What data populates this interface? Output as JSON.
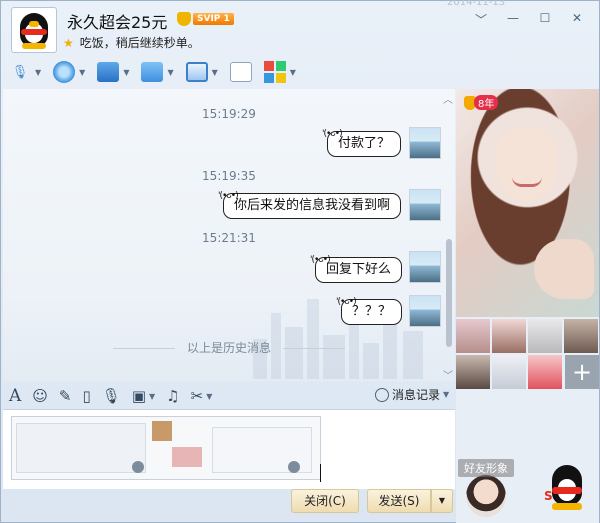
{
  "header": {
    "nickname": "永久超会25元",
    "vip_label": "SVIP 1",
    "signature": "吃饭，稍后继续秒单。",
    "faint_date": "2014-11-13",
    "controls": [
      "﹀",
      "—",
      "☐",
      "✕"
    ]
  },
  "toolbar": {
    "icons": [
      "microphone-icon",
      "camera-icon",
      "screen-share-icon",
      "send-file-icon",
      "remote-desktop-icon",
      "note-icon",
      "apps-icon"
    ]
  },
  "chat": {
    "messages": [
      {
        "time": "15:19:29",
        "text": "付款了？"
      },
      {
        "time": "15:19:35",
        "text": "你后来发的信息我没看到啊"
      },
      {
        "time": "15:21:31",
        "text": "回复下好么"
      },
      {
        "time": "",
        "text": "？？？"
      }
    ],
    "history_label": "以上是历史消息",
    "bubble_ears": "'(•ᴗ•)"
  },
  "side": {
    "badge_years": "8年",
    "add_label": "+",
    "friend_label": "好友形象"
  },
  "input_toolbar": {
    "history_label": "消息记录",
    "icons": [
      "font-icon",
      "emoji-icon",
      "magic-icon",
      "shake-icon",
      "voice-icon",
      "image-icon",
      "music-icon",
      "scissors-icon"
    ]
  },
  "buttons": {
    "close_label": "关闭(C)",
    "send_label": "发送(S)",
    "dropdown_label": "▼"
  },
  "colors": {
    "accent": "#2b70c6",
    "button_gold": "#efdcb0",
    "badge_red": "#e52e4a"
  }
}
